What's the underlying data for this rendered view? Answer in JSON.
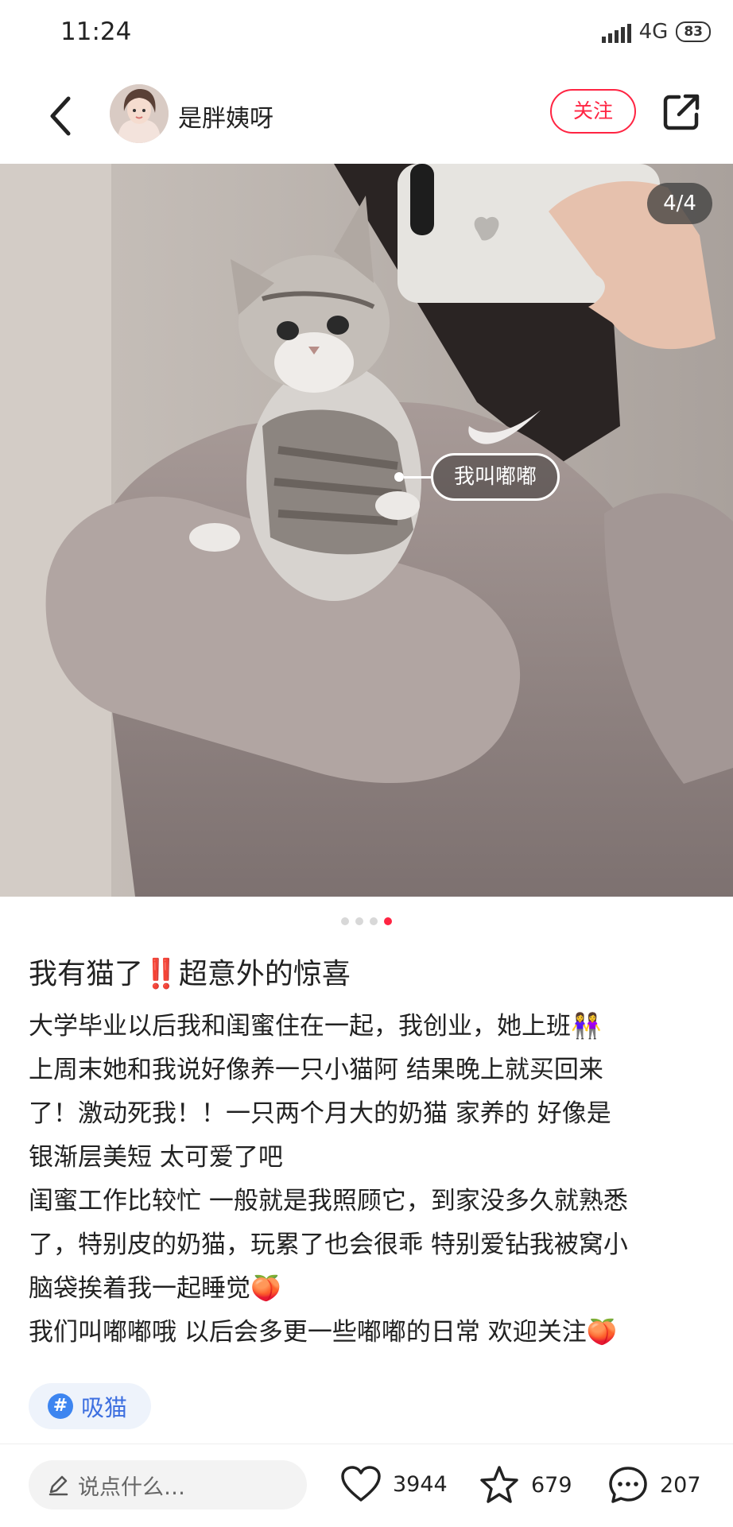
{
  "status": {
    "time": "11:24",
    "network": "4G",
    "battery": "83"
  },
  "header": {
    "author": "是胖姨呀",
    "follow_label": "关注"
  },
  "photo": {
    "counter": "4/4",
    "tag_label": "我叫嘟嘟",
    "page_count": 4,
    "current_page": 4
  },
  "post": {
    "title_before": "我有猫了",
    "title_mark": "‼️",
    "title_after": "超意外的惊喜",
    "body_lines": [
      "大学毕业以后我和闺蜜住在一起，我创业，她上班👭",
      "上周末她和我说好像养一只小猫阿 结果晚上就买回来",
      "了！激动死我！！一只两个月大的奶猫 家养的 好像是",
      "银渐层美短 太可爱了吧",
      "闺蜜工作比较忙 一般就是我照顾它，到家没多久就熟悉",
      "了，特别皮的奶猫，玩累了也会很乖 特别爱钻我被窝小",
      "脑袋挨着我一起睡觉🍑",
      "我们叫嘟嘟哦 以后会多更一些嘟嘟的日常 欢迎关注🍑"
    ],
    "hashtag_symbol": "#",
    "hashtag": "吸猫"
  },
  "bottom": {
    "comment_placeholder": "说点什么…",
    "likes": "3944",
    "collects": "679",
    "comments": "207"
  },
  "colors": {
    "accent": "#ff2442",
    "hashtag_blue": "#3d85f0"
  }
}
